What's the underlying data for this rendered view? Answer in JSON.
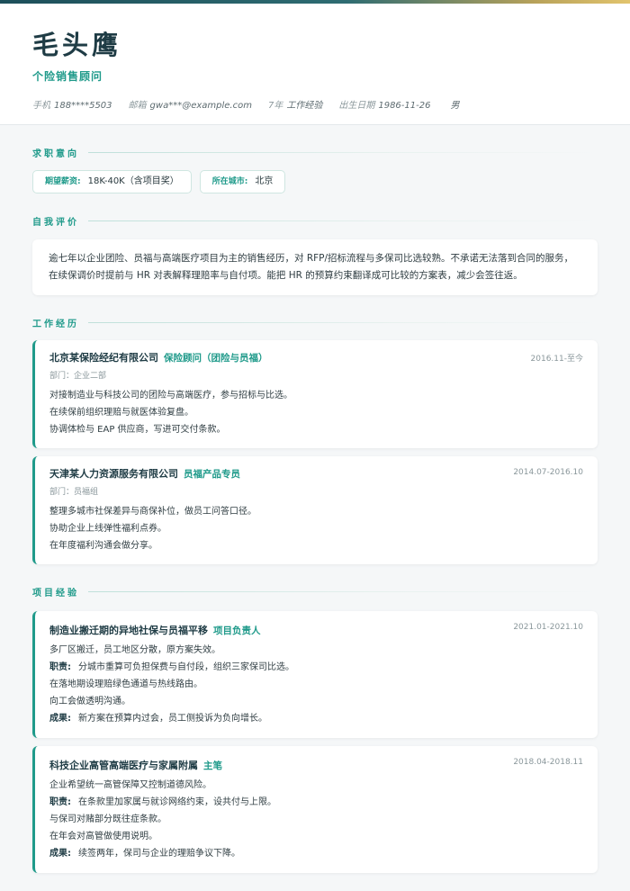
{
  "header": {
    "name": "毛头鹰",
    "title": "个险销售顾问",
    "meta": [
      {
        "label": "手机",
        "value": "188****5503"
      },
      {
        "label": "邮箱",
        "value": "gwa***@example.com"
      },
      {
        "label": "7年",
        "value": "工作经验"
      },
      {
        "label": "出生日期",
        "value": "1986-11-26"
      },
      {
        "label": "",
        "value": "男"
      }
    ]
  },
  "sections": {
    "intent": "求职意向",
    "summary": "自我评价",
    "experience": "工作经历",
    "projects": "项目经验"
  },
  "intent": {
    "salary_label": "期望薪资:",
    "salary_value": "18K-40K（含项目奖）",
    "city_label": "所在城市:",
    "city_value": "北京"
  },
  "summary": "逾七年以企业团险、员福与高端医疗项目为主的销售经历，对 RFP/招标流程与多保司比选较熟。不承诺无法落到合同的服务，在续保调价时提前与 HR 对表解释理赔率与自付项。能把 HR 的预算约束翻译成可比较的方案表，减少会签往返。",
  "experience": [
    {
      "company": "北京某保险经纪有限公司",
      "role": "保险顾问（团险与员福）",
      "date": "2016.11-至今",
      "dept": "部门：企业二部",
      "items": [
        "对接制造业与科技公司的团险与高端医疗，参与招标与比选。",
        "在续保前组织理赔与就医体验复盘。",
        "协调体检与 EAP 供应商，写进可交付条款。"
      ]
    },
    {
      "company": "天津某人力资源服务有限公司",
      "role": "员福产品专员",
      "date": "2014.07-2016.10",
      "dept": "部门：员福组",
      "items": [
        "整理多城市社保差异与商保补位，做员工问答口径。",
        "协助企业上线弹性福利点券。",
        "在年度福利沟通会做分享。"
      ]
    }
  ],
  "projects": [
    {
      "name": "制造业搬迁期的异地社保与员福平移",
      "role": "项目负责人",
      "date": "2021.01-2021.10",
      "desc": "多厂区搬迁，员工地区分散，原方案失效。",
      "duty_label": "职责:",
      "duty": "分城市重算可负担保费与自付段，组织三家保司比选。",
      "extra": [
        "在落地期设理赔绿色通道与热线路由。",
        "向工会做透明沟通。"
      ],
      "result_label": "成果:",
      "result": "新方案在预算内过会，员工侧投诉为负向增长。"
    },
    {
      "name": "科技企业高管高端医疗与家属附属",
      "role": "主笔",
      "date": "2018.04-2018.11",
      "desc": "企业希望统一高管保障又控制道德风险。",
      "duty_label": "职责:",
      "duty": "在条款里加家属与就诊网络约束，设共付与上限。",
      "extra": [
        "与保司对赌部分既往症条款。",
        "在年会对高管做使用说明。"
      ],
      "result_label": "成果:",
      "result": "续签两年，保司与企业的理赔争议下降。"
    }
  ],
  "colors": {
    "accent": "#1f9a8a",
    "heading": "#1f3c45",
    "muted": "#8a979b"
  }
}
